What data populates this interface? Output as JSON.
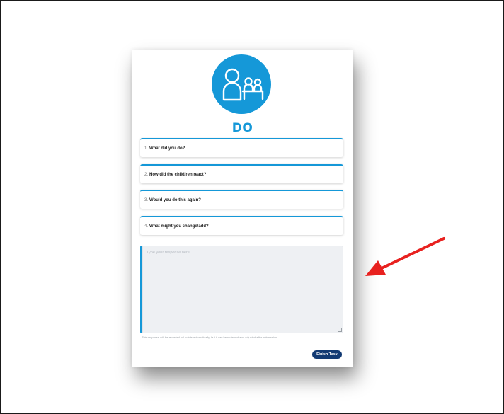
{
  "header": {
    "icon": "teacher-with-children-icon",
    "title": "DO",
    "accent_color": "#1598d8"
  },
  "questions": [
    {
      "number": "1.",
      "text": "What did you do?"
    },
    {
      "number": "2.",
      "text": "How did the child/ren react?"
    },
    {
      "number": "3.",
      "text": "Would you do this again?"
    },
    {
      "number": "4.",
      "text": "What might you change/add?"
    }
  ],
  "response": {
    "placeholder": "Type your response here",
    "value": ""
  },
  "note": "This response will be awarded full points automatically, but it can be reviewed and adjusted after submission.",
  "actions": {
    "finish_label": "Finish Task",
    "button_color": "#123a73"
  },
  "annotation": {
    "icon": "red-arrow-icon",
    "color": "#e8211f"
  }
}
